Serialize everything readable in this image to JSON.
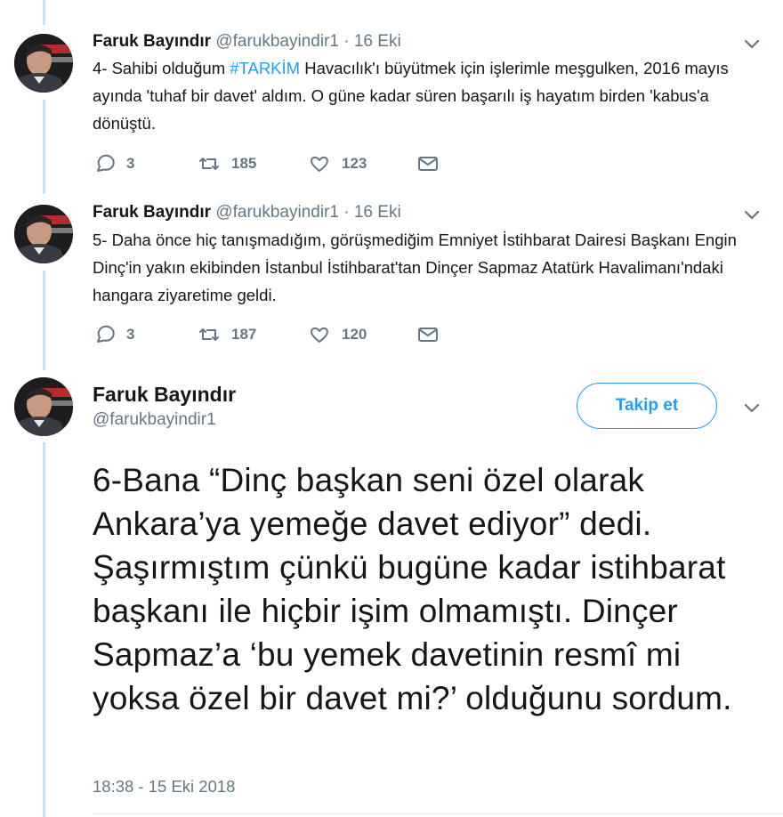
{
  "tweets": [
    {
      "name": "Faruk Bayındır",
      "handle": "@farukbayindir1",
      "separator": "·",
      "date": "16 Eki",
      "text_prefix": "4- Sahibi olduğum ",
      "hashtag": "#TARKİM",
      "text_suffix": " Havacılık'ı büyütmek için işlerimle meşgulken, 2016 mayıs ayında 'tuhaf bir davet' aldım. O güne kadar süren başarılı iş hayatım birden 'kabus'a dönüştü.",
      "replies": "3",
      "retweets": "185",
      "likes": "123"
    },
    {
      "name": "Faruk Bayındır",
      "handle": "@farukbayindir1",
      "separator": "·",
      "date": "16 Eki",
      "text": "5- Daha önce hiç tanışmadığım, görüşmediğim Emniyet İstihbarat Dairesi Başkanı Engin Dinç'in yakın ekibinden İstanbul İstihbarat'tan Dinçer Sapmaz Atatürk Havalimanı'ndaki hangara ziyaretime geldi.",
      "replies": "3",
      "retweets": "187",
      "likes": "120"
    }
  ],
  "main_tweet": {
    "name": "Faruk Bayındır",
    "handle": "@farukbayindir1",
    "follow_label": "Takip et",
    "text": "6-Bana “Dinç başkan seni özel olarak Ankara’ya yemeğe davet ediyor” dedi. Şaşırmıştım çünkü bugüne kadar istihbarat başkanı ile hiçbir işim olmamıştı. Dinçer Sapmaz’a ‘bu yemek davetinin resmî mi yoksa özel bir davet mi?’ olduğunu sordum.",
    "timestamp": "18:38 - 15 Eki 2018"
  },
  "colors": {
    "accent": "#1da1f2",
    "muted": "#657786",
    "thread_line": "#c4e2f5",
    "text": "#14171a"
  },
  "icons": [
    "reply-icon",
    "retweet-icon",
    "like-icon",
    "message-icon",
    "chevron-down-icon"
  ]
}
